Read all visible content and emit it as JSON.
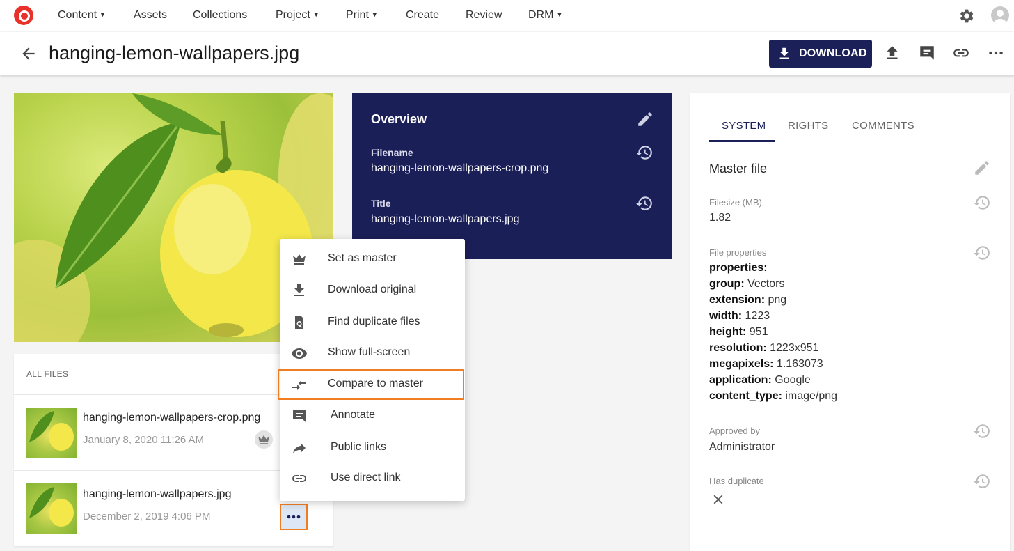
{
  "nav": {
    "items": [
      {
        "label": "Content",
        "dropdown": true
      },
      {
        "label": "Assets",
        "dropdown": false
      },
      {
        "label": "Collections",
        "dropdown": false
      },
      {
        "label": "Project",
        "dropdown": true
      },
      {
        "label": "Print",
        "dropdown": true
      },
      {
        "label": "Create",
        "dropdown": false
      },
      {
        "label": "Review",
        "dropdown": false
      },
      {
        "label": "DRM",
        "dropdown": true
      }
    ]
  },
  "header": {
    "title": "hanging-lemon-wallpapers.jpg",
    "download_label": "DOWNLOAD"
  },
  "files": {
    "heading": "ALL FILES",
    "items": [
      {
        "name": "hanging-lemon-wallpapers-crop.png",
        "date": "January 8, 2020 11:26 AM",
        "is_master": true
      },
      {
        "name": "hanging-lemon-wallpapers.jpg",
        "date": "December 2, 2019 4:06 PM",
        "is_master": false
      }
    ]
  },
  "overview": {
    "title": "Overview",
    "fields": [
      {
        "label": "Filename",
        "value": "hanging-lemon-wallpapers-crop.png"
      },
      {
        "label": "Title",
        "value": "hanging-lemon-wallpapers.jpg"
      }
    ]
  },
  "panel": {
    "tabs": [
      "SYSTEM",
      "RIGHTS",
      "COMMENTS"
    ],
    "active_tab": "SYSTEM",
    "section_title": "Master file",
    "filesize_label": "Filesize (MB)",
    "filesize_value": "1.82",
    "file_properties_label": "File properties",
    "properties": [
      {
        "key": "properties:",
        "value": ""
      },
      {
        "key": "group:",
        "value": "Vectors"
      },
      {
        "key": "extension:",
        "value": "png"
      },
      {
        "key": "width:",
        "value": "1223"
      },
      {
        "key": "height:",
        "value": "951"
      },
      {
        "key": "resolution:",
        "value": "1223x951"
      },
      {
        "key": "megapixels:",
        "value": "1.163073"
      },
      {
        "key": "application:",
        "value": "Google"
      },
      {
        "key": "content_type:",
        "value": "image/png"
      }
    ],
    "approved_by_label": "Approved by",
    "approved_by_value": "Administrator",
    "has_duplicate_label": "Has duplicate"
  },
  "menu": {
    "items": [
      {
        "label": "Set as master",
        "icon": "crown-icon"
      },
      {
        "label": "Download original",
        "icon": "download-icon"
      },
      {
        "label": "Find duplicate files",
        "icon": "find-file-icon"
      },
      {
        "label": "Show full-screen",
        "icon": "eye-icon"
      },
      {
        "label": "Compare to master",
        "icon": "compare-icon"
      },
      {
        "label": "Annotate",
        "icon": "comment-icon"
      },
      {
        "label": "Public links",
        "icon": "share-icon"
      },
      {
        "label": "Use direct link",
        "icon": "link-icon"
      }
    ]
  },
  "colors": {
    "brand_navy": "#1b2158",
    "overview_bg": "#1b1f57",
    "highlight_orange": "#f07d22",
    "logo_red": "#e8312a"
  }
}
